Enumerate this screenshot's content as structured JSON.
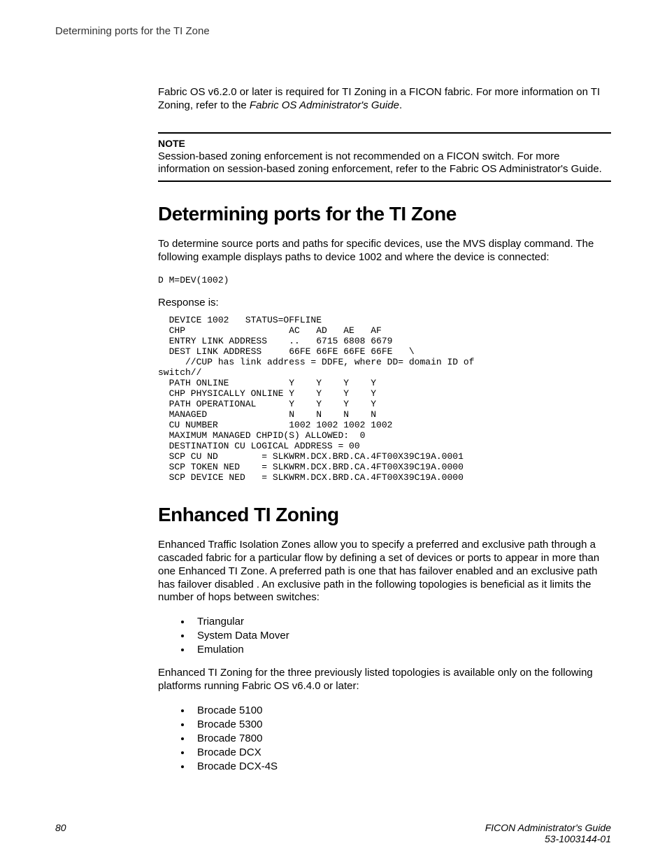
{
  "running_head": "Determining ports for the TI Zone",
  "intro_para": "Fabric OS v6.2.0 or later is required for TI Zoning in a FICON fabric. For more information on TI Zoning, refer to the ",
  "intro_italic": "Fabric OS Administrator's Guide",
  "intro_tail": ".",
  "note": {
    "label": "NOTE",
    "body": "Session-based zoning enforcement is not recommended on a FICON switch. For more information on session-based zoning enforcement, refer to the Fabric OS Administrator's Guide."
  },
  "sec1": {
    "title": "Determining ports for the TI Zone",
    "para": "To determine source ports and paths for specific devices, use the MVS display command. The following example displays paths to device 1002 and where the device is connected:",
    "cmd": "D M=DEV(1002)",
    "resp_label": "Response is:",
    "resp": "  DEVICE 1002   STATUS=OFFLINE\n  CHP                   AC   AD   AE   AF\n  ENTRY LINK ADDRESS    ..   6715 6808 6679\n  DEST LINK ADDRESS     66FE 66FE 66FE 66FE   \\\n     //CUP has link address = DDFE, where DD= domain ID of\nswitch//\n  PATH ONLINE           Y    Y    Y    Y\n  CHP PHYSICALLY ONLINE Y    Y    Y    Y\n  PATH OPERATIONAL      Y    Y    Y    Y\n  MANAGED               N    N    N    N\n  CU NUMBER             1002 1002 1002 1002\n  MAXIMUM MANAGED CHPID(S) ALLOWED:  0\n  DESTINATION CU LOGICAL ADDRESS = 00\n  SCP CU ND        = SLKWRM.DCX.BRD.CA.4FT00X39C19A.0001\n  SCP TOKEN NED    = SLKWRM.DCX.BRD.CA.4FT00X39C19A.0000\n  SCP DEVICE NED   = SLKWRM.DCX.BRD.CA.4FT00X39C19A.0000"
  },
  "sec2": {
    "title": "Enhanced TI Zoning",
    "para1": "Enhanced Traffic Isolation Zones allow you to specify a preferred and exclusive path through a cascaded fabric for a particular flow by defining a set of devices or ports to appear in more than one Enhanced TI Zone. A preferred path is one that has failover enabled and an exclusive path has failover disabled . An exclusive path in the following topologies is beneficial as it limits the number of hops between switches:",
    "list1": [
      "Triangular",
      "System Data Mover",
      "Emulation"
    ],
    "para2": "Enhanced TI Zoning for the three previously listed topologies is available only on the following platforms running Fabric OS v6.4.0 or later:",
    "list2": [
      "Brocade 5100",
      "Brocade 5300",
      "Brocade 7800",
      "Brocade DCX",
      "Brocade DCX-4S"
    ]
  },
  "footer": {
    "page": "80",
    "title": "FICON Administrator's Guide",
    "docnum": "53-1003144-01"
  }
}
